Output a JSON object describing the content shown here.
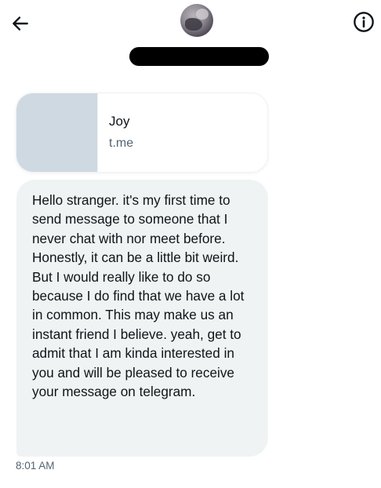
{
  "header": {
    "back_icon": "arrow-left-icon",
    "info_icon": "info-circle-icon",
    "name_redacted": true
  },
  "link_card": {
    "title": "Joy",
    "domain": "t.me"
  },
  "message": {
    "text": "Hello stranger. it's my first time to send message to someone that I never chat with nor meet before. Honestly, it can be a little bit weird. But I would really like to do so because I do find that we have a lot in common. This may make us an instant friend I believe. yeah, get to admit that I am kinda interested in you and will be pleased to receive your message on telegram.",
    "timestamp": "8:01 AM"
  },
  "colors": {
    "bubble_bg": "#eff3f4",
    "thumb_bg": "#cfd9e2",
    "secondary_text": "#536471",
    "primary_text": "#0f1419"
  }
}
